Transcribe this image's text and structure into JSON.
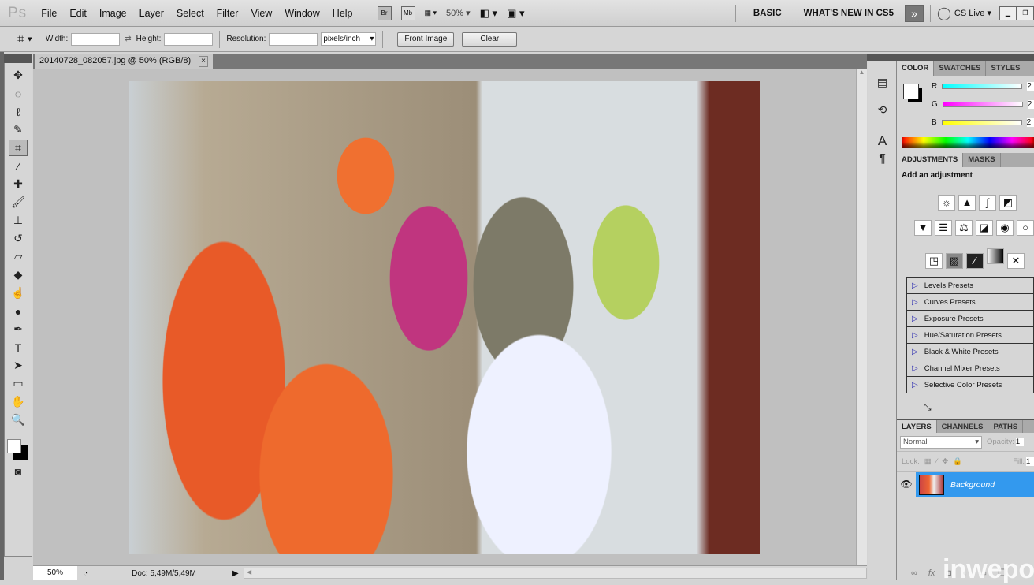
{
  "app": {
    "logo": "Ps"
  },
  "menu": [
    "File",
    "Edit",
    "Image",
    "Layer",
    "Select",
    "Filter",
    "View",
    "Window",
    "Help"
  ],
  "appbar": {
    "bridge": "Br",
    "minibridge": "Mb",
    "zoom": "50%",
    "workspaces": [
      "BASIC",
      "WHAT'S NEW IN CS5"
    ],
    "more": "»",
    "cslive": "CS Live"
  },
  "options": {
    "width_label": "Width:",
    "width_value": "",
    "height_label": "Height:",
    "height_value": "",
    "resolution_label": "Resolution:",
    "resolution_value": "",
    "units": "pixels/inch",
    "front_image": "Front Image",
    "clear": "Clear"
  },
  "document": {
    "tab_title": "20140728_082057.jpg @ 50% (RGB/8)",
    "close": "×"
  },
  "status": {
    "zoom": "50%",
    "doc": "Doc: 5,49M/5,49M"
  },
  "color_panel": {
    "tabs": [
      "COLOR",
      "SWATCHES",
      "STYLES"
    ],
    "channels": [
      {
        "label": "R",
        "value": "2"
      },
      {
        "label": "G",
        "value": "2"
      },
      {
        "label": "B",
        "value": "2"
      }
    ]
  },
  "adjustments_panel": {
    "tabs": [
      "ADJUSTMENTS",
      "MASKS"
    ],
    "title": "Add an adjustment",
    "presets": [
      "Levels Presets",
      "Curves Presets",
      "Exposure Presets",
      "Hue/Saturation Presets",
      "Black & White Presets",
      "Channel Mixer Presets",
      "Selective Color Presets"
    ]
  },
  "layers_panel": {
    "tabs": [
      "LAYERS",
      "CHANNELS",
      "PATHS"
    ],
    "blend_mode": "Normal",
    "opacity_label": "Opacity:",
    "opacity_value": "1",
    "lock_label": "Lock:",
    "fill_label": "Fill:",
    "fill_value": "1",
    "layers": [
      {
        "name": "Background",
        "selected": true
      }
    ]
  },
  "watermark": "inwepo",
  "colors": {
    "selection": "#3399ee",
    "panel": "#d6d6d6",
    "canvas": "#c0c0c0"
  }
}
